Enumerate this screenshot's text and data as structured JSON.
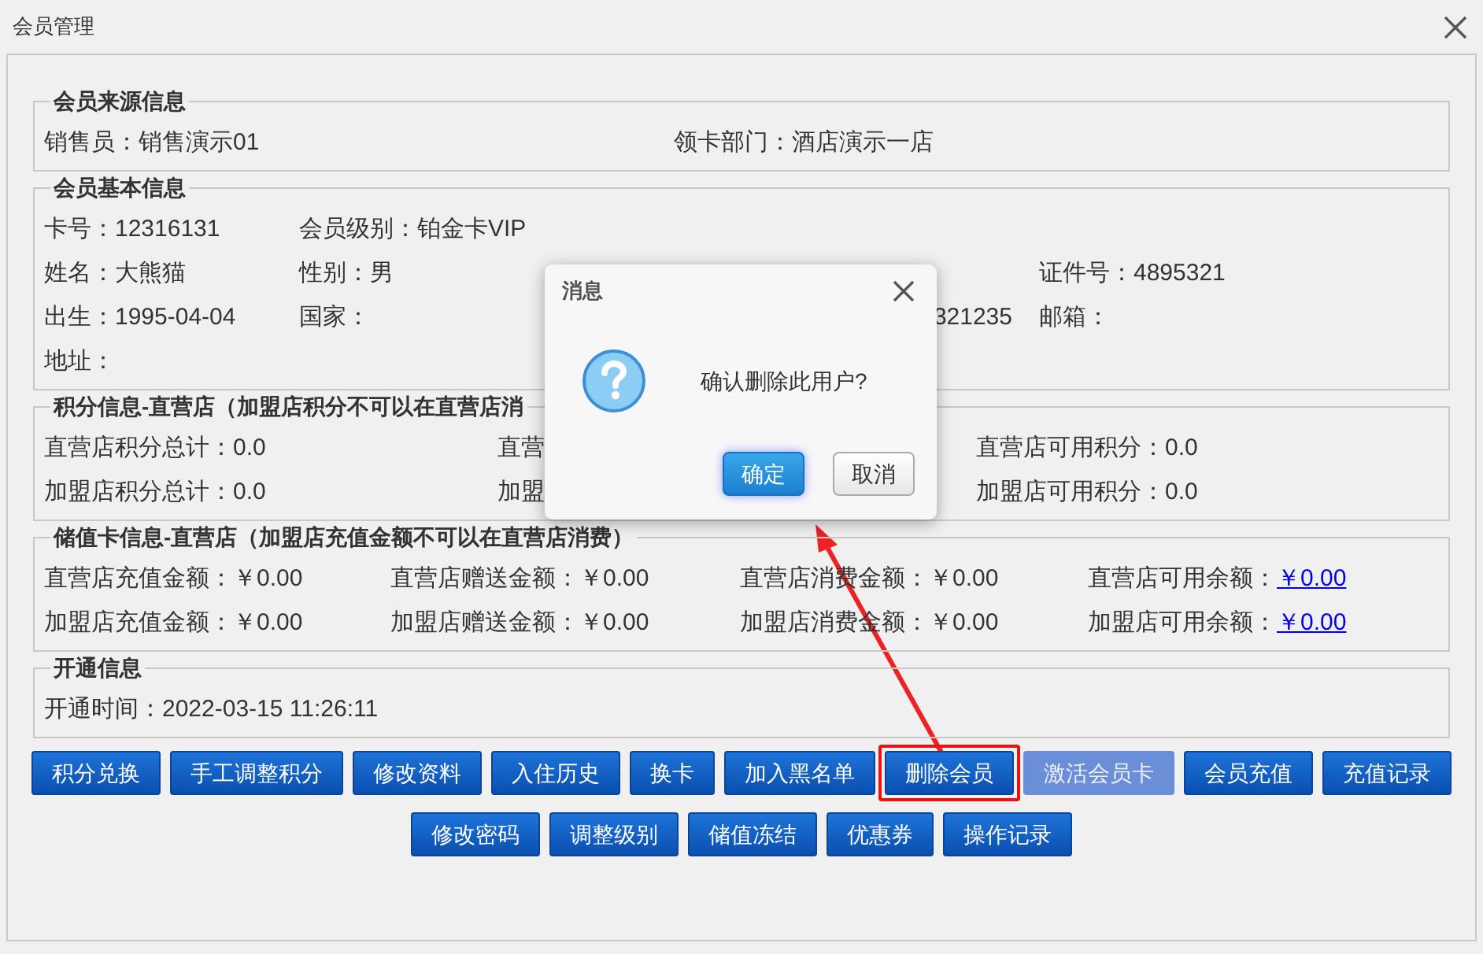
{
  "window": {
    "title": "会员管理"
  },
  "sections": [
    {
      "title": "会员来源信息",
      "rows": [
        {
          "column_1": {
            "text": "销售员：销售演示01"
          },
          "column_2": {
            "text": "领卡部门：酒店演示一店"
          }
        }
      ]
    },
    {
      "title": "会员基本信息",
      "rows": [
        {
          "column_1": {
            "text": "卡号：12316131"
          },
          "column_2": {
            "text": "会员级别：铂金卡VIP"
          }
        },
        {
          "column_1": {
            "text": "姓名：大熊猫"
          },
          "column_2": {
            "text": "性别：男"
          },
          "column_4": {
            "text": "证件号：4895321"
          }
        },
        {
          "column_1": {
            "text": "出生：1995-04-04"
          },
          "column_2": {
            "text": "国家："
          },
          "column_3": {
            "text": "321235"
          },
          "column_4": {
            "text": "邮箱："
          }
        },
        {
          "column_1": {
            "text": "地址："
          }
        }
      ]
    },
    {
      "title": "积分信息-直营店（加盟店积分不可以在直营店消",
      "rows": [
        {
          "column_1": {
            "text": "直营店积分总计：0.0"
          },
          "column_2": {
            "text": "直营"
          },
          "column_3": {
            "text": "直营店可用积分：0.0"
          }
        },
        {
          "column_1": {
            "text": "加盟店积分总计：0.0"
          },
          "column_2": {
            "text": "加盟"
          },
          "column_3": {
            "text": "加盟店可用积分：0.0"
          }
        }
      ]
    },
    {
      "title": "储值卡信息-直营店（加盟店充值金额不可以在直营店消费）",
      "rows": [
        {
          "column_1": {
            "text": "直营店充值金额：￥0.00"
          },
          "column_2": {
            "text": "直营店赠送金额：￥0.00"
          },
          "column_3": {
            "text": "直营店消费金额：￥0.00"
          },
          "column_4": {
            "text": "直营店可用余额：",
            "link": "￥0.00"
          }
        },
        {
          "column_1": {
            "text": "加盟店充值金额：￥0.00"
          },
          "column_2": {
            "text": "加盟店赠送金额：￥0.00"
          },
          "column_3": {
            "text": "加盟店消费金额：￥0.00"
          },
          "column_4": {
            "text": "加盟店可用余额：",
            "link": "￥0.00"
          }
        }
      ]
    },
    {
      "title": "开通信息",
      "rows": [
        {
          "column_1": {
            "text": "开通时间：2022-03-15 11:26:11"
          }
        }
      ]
    }
  ],
  "button_rows": [
    [
      {
        "label": "积分兑换",
        "disabled": false,
        "highlighted": false
      },
      {
        "label": "手工调整积分",
        "disabled": false,
        "highlighted": false
      },
      {
        "label": "修改资料",
        "disabled": false,
        "highlighted": false
      },
      {
        "label": "入住历史",
        "disabled": false,
        "highlighted": false
      },
      {
        "label": "换卡",
        "disabled": false,
        "highlighted": false
      },
      {
        "label": "加入黑名单",
        "disabled": false,
        "highlighted": false
      },
      {
        "label": "删除会员",
        "disabled": false,
        "highlighted": true
      },
      {
        "label": "激活会员卡",
        "disabled": true,
        "highlighted": false
      },
      {
        "label": "会员充值",
        "disabled": false,
        "highlighted": false
      },
      {
        "label": "充值记录",
        "disabled": false,
        "highlighted": false
      }
    ],
    [
      {
        "label": "修改密码",
        "disabled": false,
        "highlighted": false
      },
      {
        "label": "调整级别",
        "disabled": false,
        "highlighted": false
      },
      {
        "label": "储值冻结",
        "disabled": false,
        "highlighted": false
      },
      {
        "label": "优惠券",
        "disabled": false,
        "highlighted": false
      },
      {
        "label": "操作记录",
        "disabled": false,
        "highlighted": false
      }
    ]
  ],
  "dialog": {
    "title": "消息",
    "message": "确认删除此用户?",
    "buttons": [
      {
        "label": "确定",
        "kind": "primary"
      },
      {
        "label": "取消",
        "kind": "secondary"
      }
    ]
  }
}
